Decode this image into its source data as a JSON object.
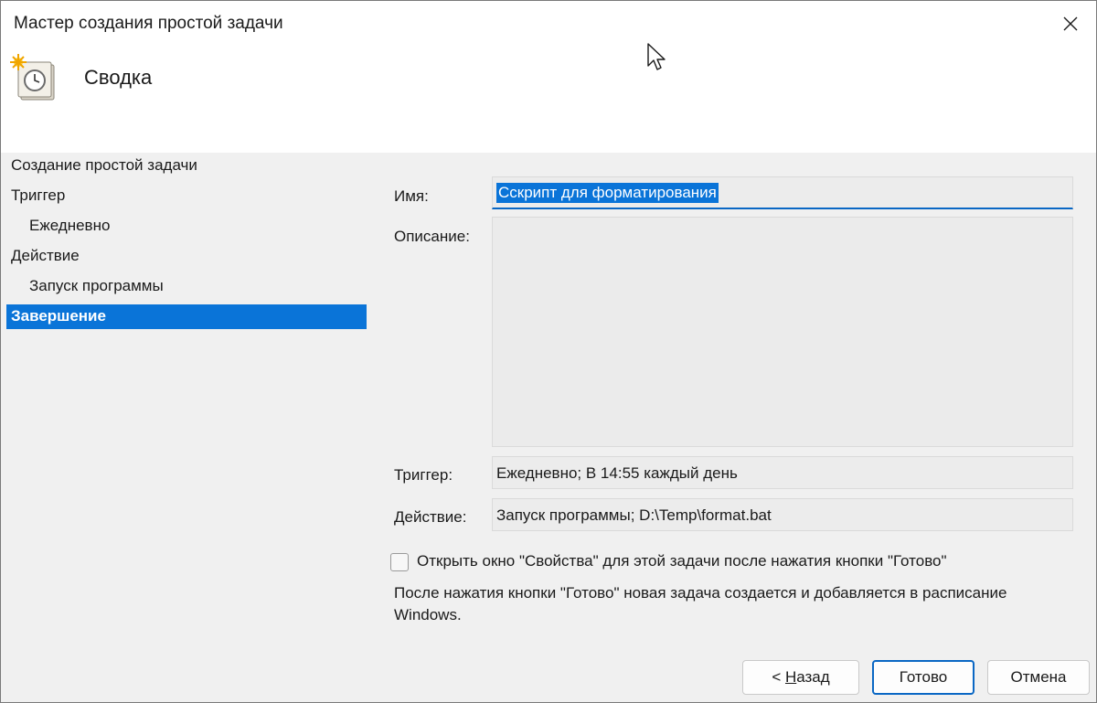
{
  "window": {
    "title": "Мастер создания простой задачи"
  },
  "header": {
    "title": "Сводка",
    "icon": "task-scheduler-clock-icon"
  },
  "steps": [
    {
      "label": "Создание простой задачи",
      "sub": false,
      "active": false
    },
    {
      "label": "Триггер",
      "sub": false,
      "active": false
    },
    {
      "label": "Ежедневно",
      "sub": true,
      "active": false
    },
    {
      "label": "Действие",
      "sub": false,
      "active": false
    },
    {
      "label": "Запуск программы",
      "sub": true,
      "active": false
    },
    {
      "label": "Завершение",
      "sub": false,
      "active": true
    }
  ],
  "form": {
    "name_label": "Имя:",
    "name_value": "Сскрипт для форматирования",
    "description_label": "Описание:",
    "description_value": "",
    "trigger_label": "Триггер:",
    "trigger_value": "Ежедневно; В 14:55 каждый день",
    "action_label": "Действие:",
    "action_value": "Запуск программы; D:\\Temp\\format.bat",
    "open_properties_label": "Открыть окно \"Свойства\" для этой задачи после нажатия кнопки \"Готово\"",
    "open_properties_checked": false,
    "note": "После нажатия кнопки \"Готово\" новая задача создается и добавляется в расписание Windows."
  },
  "buttons": {
    "back_prefix": "< ",
    "back_mnemonic": "Н",
    "back_rest": "азад",
    "finish": "Готово",
    "cancel": "Отмена"
  },
  "colors": {
    "selection": "#0a74d8",
    "accent_border": "#0a67c4"
  }
}
